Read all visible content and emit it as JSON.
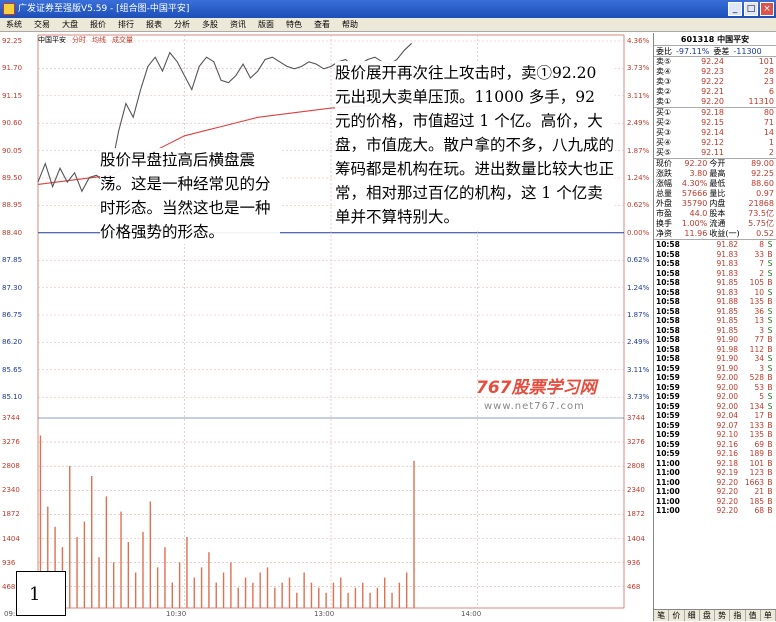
{
  "window": {
    "title": "广发证券至强版V5.59 - [组合图-中国平安]",
    "buttons": [
      "_",
      "□",
      "×"
    ]
  },
  "menu": [
    "系统",
    "交易",
    "大盘",
    "报价",
    "排行",
    "报表",
    "分析",
    "多股",
    "资讯",
    "版面",
    "特色",
    "查看",
    "帮助"
  ],
  "chart_header": {
    "name": "中国平安",
    "mode": "分时",
    "lines": "均线",
    "volume": "成交量"
  },
  "price_axis": {
    "left": [
      "92.25",
      "91.70",
      "91.15",
      "90.60",
      "90.05",
      "89.50",
      "88.95",
      "88.40",
      "87.85",
      "87.30",
      "86.75",
      "86.20",
      "85.65",
      "85.10"
    ],
    "right": [
      "4.36%",
      "3.73%",
      "3.11%",
      "2.49%",
      "1.87%",
      "1.24%",
      "0.62%",
      "0.00%",
      "0.62%",
      "1.24%",
      "1.87%",
      "2.49%",
      "3.11%",
      "3.73%"
    ],
    "base": "88.40"
  },
  "volume_axis": [
    "3744",
    "3276",
    "2808",
    "2340",
    "1872",
    "1404",
    "936",
    "468"
  ],
  "time_axis": [
    "09:30",
    "10:30",
    "13:00",
    "14:00"
  ],
  "annotations": {
    "left": "股价早盘拉高后横盘震荡。这是一种经常见的分时形态。当然这也是一种价格强势的形态。",
    "right": "股价展开再次往上攻击时，卖①92.20 元出现大卖单压顶。11000 多手，92 元的价格，市值超过 1 个亿。高价，大盘，市值庞大。散户拿的不多，八九成的筹码都是机构在玩。进出数量比较大也正常，相对那过百亿的机构，这 1 个亿卖单并不算特别大。"
  },
  "figure_label": "1",
  "watermark": {
    "logo": "767股票学习网",
    "url": "www.net767.com"
  },
  "stock": {
    "code": "601318",
    "name": "中国平安",
    "weibi_label": "委比",
    "weibi": "-97.11%",
    "weicha_label": "委差",
    "weicha": "-11300"
  },
  "sell_orders": [
    {
      "label": "卖⑤",
      "price": "92.24",
      "vol": "101"
    },
    {
      "label": "卖④",
      "price": "92.23",
      "vol": "28"
    },
    {
      "label": "卖③",
      "price": "92.22",
      "vol": "23"
    },
    {
      "label": "卖②",
      "price": "92.21",
      "vol": "6"
    },
    {
      "label": "卖①",
      "price": "92.20",
      "vol": "11310"
    }
  ],
  "buy_orders": [
    {
      "label": "买①",
      "price": "92.18",
      "vol": "80"
    },
    {
      "label": "买②",
      "price": "92.15",
      "vol": "71"
    },
    {
      "label": "买③",
      "price": "92.14",
      "vol": "14"
    },
    {
      "label": "买④",
      "price": "92.12",
      "vol": "1"
    },
    {
      "label": "买⑤",
      "price": "92.11",
      "vol": "2"
    }
  ],
  "stats": [
    {
      "l1": "现价",
      "v1": "92.20",
      "l2": "今开",
      "v2": "89.00"
    },
    {
      "l1": "涨跌",
      "v1": "3.80",
      "l2": "最高",
      "v2": "92.25"
    },
    {
      "l1": "涨幅",
      "v1": "4.30%",
      "l2": "最低",
      "v2": "88.60"
    },
    {
      "l1": "总量",
      "v1": "57666",
      "l2": "量比",
      "v2": "0.97"
    },
    {
      "l1": "外盘",
      "v1": "35790",
      "l2": "内盘",
      "v2": "21868"
    },
    {
      "l1": "市盈",
      "v1": "44.0",
      "l2": "股本",
      "v2": "73.5亿"
    },
    {
      "l1": "换手",
      "v1": "1.00%",
      "l2": "流通",
      "v2": "5.75亿"
    },
    {
      "l1": "净资",
      "v1": "11.96",
      "l2": "收益(一)",
      "v2": "0.52"
    }
  ],
  "ticks": [
    {
      "t": "10:58",
      "p": "91.82",
      "v": "8",
      "bs": "S"
    },
    {
      "t": "10:58",
      "p": "91.83",
      "v": "33",
      "bs": "B"
    },
    {
      "t": "10:58",
      "p": "91.83",
      "v": "7",
      "bs": "S"
    },
    {
      "t": "10:58",
      "p": "91.83",
      "v": "2",
      "bs": "S"
    },
    {
      "t": "10:58",
      "p": "91.85",
      "v": "105",
      "bs": "B"
    },
    {
      "t": "10:58",
      "p": "91.83",
      "v": "10",
      "bs": "S"
    },
    {
      "t": "10:58",
      "p": "91.88",
      "v": "135",
      "bs": "B"
    },
    {
      "t": "10:58",
      "p": "91.85",
      "v": "36",
      "bs": "S"
    },
    {
      "t": "10:58",
      "p": "91.85",
      "v": "13",
      "bs": "S"
    },
    {
      "t": "10:58",
      "p": "91.85",
      "v": "3",
      "bs": "S"
    },
    {
      "t": "10:58",
      "p": "91.90",
      "v": "77",
      "bs": "B"
    },
    {
      "t": "10:58",
      "p": "91.98",
      "v": "112",
      "bs": "B"
    },
    {
      "t": "10:58",
      "p": "91.90",
      "v": "34",
      "bs": "S"
    },
    {
      "t": "10:59",
      "p": "91.90",
      "v": "3",
      "bs": "S"
    },
    {
      "t": "10:59",
      "p": "92.00",
      "v": "528",
      "bs": "B"
    },
    {
      "t": "10:59",
      "p": "92.00",
      "v": "53",
      "bs": "B"
    },
    {
      "t": "10:59",
      "p": "92.00",
      "v": "5",
      "bs": "S"
    },
    {
      "t": "10:59",
      "p": "92.00",
      "v": "134",
      "bs": "S"
    },
    {
      "t": "10:59",
      "p": "92.04",
      "v": "17",
      "bs": "B"
    },
    {
      "t": "10:59",
      "p": "92.07",
      "v": "133",
      "bs": "B"
    },
    {
      "t": "10:59",
      "p": "92.10",
      "v": "135",
      "bs": "B"
    },
    {
      "t": "10:59",
      "p": "92.16",
      "v": "69",
      "bs": "B"
    },
    {
      "t": "10:59",
      "p": "92.16",
      "v": "189",
      "bs": "B"
    },
    {
      "t": "11:00",
      "p": "92.18",
      "v": "101",
      "bs": "B"
    },
    {
      "t": "11:00",
      "p": "92.19",
      "v": "123",
      "bs": "B"
    },
    {
      "t": "11:00",
      "p": "92.20",
      "v": "1663",
      "bs": "B"
    },
    {
      "t": "11:00",
      "p": "92.20",
      "v": "21",
      "bs": "B"
    },
    {
      "t": "11:00",
      "p": "92.20",
      "v": "185",
      "bs": "B"
    },
    {
      "t": "11:00",
      "p": "92.20",
      "v": "68",
      "bs": "B"
    }
  ],
  "panel_tabs": [
    "笔",
    "价",
    "细",
    "盘",
    "势",
    "指",
    "值",
    "单"
  ],
  "chart_data": {
    "type": "line",
    "price_range": [
      84.55,
      92.25
    ],
    "volume_max": 3744,
    "price_series": [
      [
        0,
        89.2
      ],
      [
        3,
        89.6
      ],
      [
        6,
        89.1
      ],
      [
        9,
        89.5
      ],
      [
        12,
        89.2
      ],
      [
        15,
        89.4
      ],
      [
        18,
        89.0
      ],
      [
        21,
        89.3
      ],
      [
        24,
        89.35
      ],
      [
        27,
        89.2
      ],
      [
        30,
        89.5
      ],
      [
        33,
        90.3
      ],
      [
        36,
        90.9
      ],
      [
        39,
        90.6
      ],
      [
        42,
        91.2
      ],
      [
        45,
        91.7
      ],
      [
        48,
        91.9
      ],
      [
        51,
        91.6
      ],
      [
        54,
        92.0
      ],
      [
        57,
        91.8
      ],
      [
        60,
        91.5
      ],
      [
        63,
        91.2
      ],
      [
        66,
        91.7
      ],
      [
        69,
        91.9
      ],
      [
        72,
        91.8
      ],
      [
        75,
        91.4
      ],
      [
        78,
        91.35
      ],
      [
        81,
        91.5
      ],
      [
        84,
        91.75
      ],
      [
        87,
        91.45
      ],
      [
        90,
        91.6
      ],
      [
        93,
        91.85
      ],
      [
        96,
        91.9
      ],
      [
        99,
        91.8
      ],
      [
        102,
        91.7
      ],
      [
        105,
        91.65
      ],
      [
        108,
        91.7
      ],
      [
        111,
        91.8
      ],
      [
        114,
        91.75
      ],
      [
        117,
        91.65
      ],
      [
        120,
        91.7
      ],
      [
        123,
        91.8
      ],
      [
        126,
        91.85
      ],
      [
        129,
        91.7
      ],
      [
        132,
        91.75
      ],
      [
        135,
        91.85
      ],
      [
        138,
        91.9
      ],
      [
        141,
        91.8
      ],
      [
        144,
        91.75
      ],
      [
        147,
        91.85
      ],
      [
        150,
        92.05
      ],
      [
        153,
        92.2
      ]
    ],
    "avg_series": [
      [
        0,
        89.15
      ],
      [
        15,
        89.25
      ],
      [
        30,
        89.35
      ],
      [
        45,
        89.8
      ],
      [
        60,
        90.2
      ],
      [
        75,
        90.4
      ],
      [
        90,
        90.6
      ],
      [
        105,
        90.7
      ],
      [
        120,
        90.8
      ],
      [
        135,
        90.85
      ],
      [
        150,
        90.95
      ],
      [
        153,
        91.0
      ]
    ],
    "volume_series": [
      3400,
      2000,
      1600,
      1200,
      2800,
      1400,
      1700,
      2600,
      1000,
      2200,
      900,
      1900,
      1300,
      700,
      1500,
      2100,
      800,
      1200,
      500,
      900,
      1400,
      600,
      800,
      1100,
      500,
      700,
      900,
      400,
      600,
      500,
      700,
      800,
      400,
      500,
      600,
      300,
      700,
      500,
      400,
      300,
      500,
      600,
      300,
      400,
      500,
      300,
      400,
      600,
      300,
      500,
      700,
      2900
    ]
  }
}
